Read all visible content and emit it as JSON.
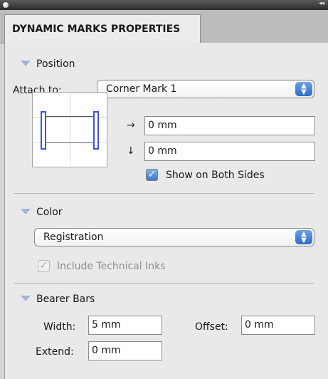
{
  "panel_title": "DYNAMIC MARKS PROPERTIES",
  "position": {
    "heading": "Position",
    "attach_label": "Attach to:",
    "attach_value": "Corner Mark 1",
    "horizontal_value": "0 mm",
    "vertical_value": "0 mm",
    "show_both_sides_label": "Show on Both Sides",
    "show_both_sides_checked": true,
    "icon_horizontal": "→",
    "icon_vertical": "↓"
  },
  "color": {
    "heading": "Color",
    "select_value": "Registration",
    "include_inks_label": "Include Technical Inks",
    "include_inks_checked": true
  },
  "bearer_bars": {
    "heading": "Bearer Bars",
    "width_label": "Width:",
    "width_value": "5 mm",
    "offset_label": "Offset:",
    "offset_value": "0 mm",
    "extend_label": "Extend:",
    "extend_value": "0 mm"
  },
  "colors": {
    "accent_blue": "#2f6cc4",
    "bar_blue": "#3a55e6"
  }
}
